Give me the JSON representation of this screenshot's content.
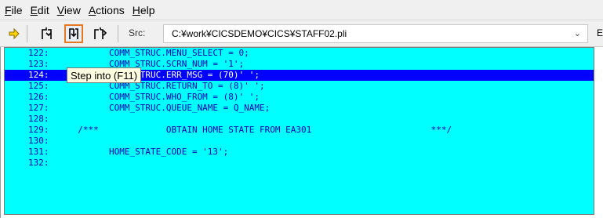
{
  "menu": [
    {
      "label": "File",
      "mnemonic": "F"
    },
    {
      "label": "Edit",
      "mnemonic": "E"
    },
    {
      "label": "View",
      "mnemonic": "V"
    },
    {
      "label": "Actions",
      "mnemonic": "A"
    },
    {
      "label": "Help",
      "mnemonic": "H"
    }
  ],
  "toolbar": {
    "src_label": "Src:",
    "src_path": "C:¥work¥CICSDEMO¥CICS¥STAFF02.pli",
    "trailing": "E",
    "buttons": [
      "run-arrow-icon",
      "step-over-icon",
      "step-into-icon",
      "step-return-icon"
    ],
    "accent": "#e87722"
  },
  "tooltip": "Step into (F11)",
  "code": {
    "current_line": "124:",
    "lines": [
      {
        "no": "122:",
        "text": "        COMM_STRUC.MENU_SELECT = 0;"
      },
      {
        "no": "123:",
        "text": "        COMM_STRUC.SCRN_NUM = '1';"
      },
      {
        "no": "124:",
        "text": "        COMM_STRUC.ERR_MSG = (70)' ';"
      },
      {
        "no": "125:",
        "text": "        COMM_STRUC.RETURN_TO = (8)' ';"
      },
      {
        "no": "126:",
        "text": "        COMM_STRUC.WHO_FROM = (8)' ';"
      },
      {
        "no": "127:",
        "text": "        COMM_STRUC.QUEUE_NAME = Q_NAME;"
      },
      {
        "no": "128:",
        "text": ""
      },
      {
        "no": "129:",
        "text": "  /***             OBTAIN HOME STATE FROM EA301                       ***/"
      },
      {
        "no": "130:",
        "text": ""
      },
      {
        "no": "131:",
        "text": "        HOME_STATE_CODE = '13';"
      },
      {
        "no": "132:",
        "text": ""
      }
    ],
    "colors": {
      "background": "#00ffff",
      "text": "#0000b0",
      "highlight": "#0000ff"
    }
  }
}
